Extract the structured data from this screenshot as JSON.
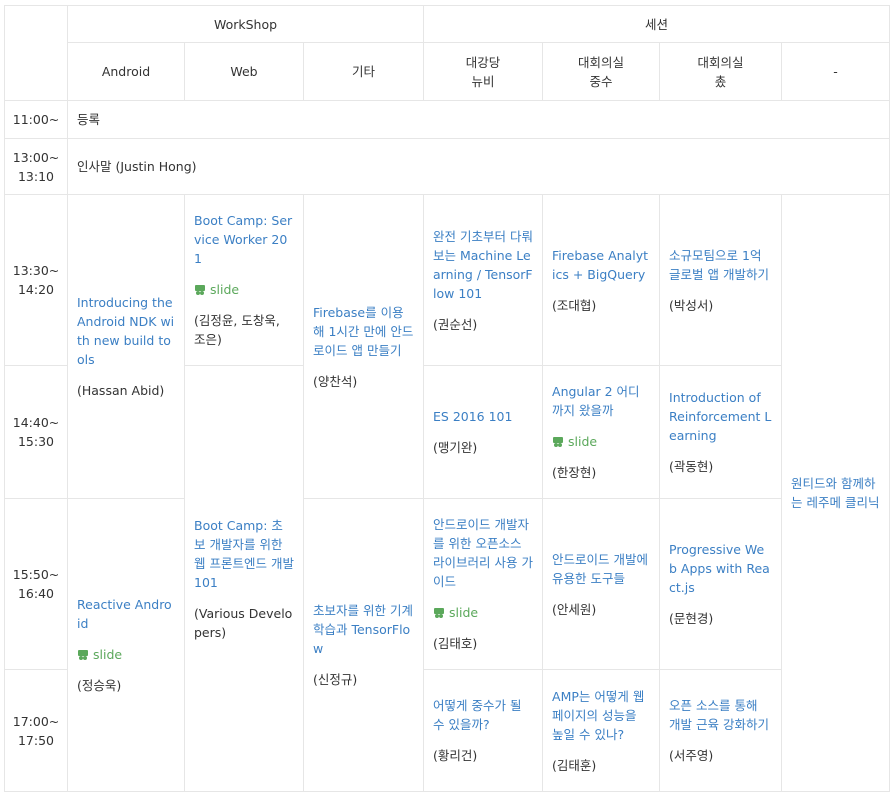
{
  "header": {
    "workshop": "WorkShop",
    "session": "세션",
    "cols": [
      "Android",
      "Web",
      "기타",
      "대강당\n뉴비",
      "대회의실\n중수",
      "대회의실\n촜",
      "-"
    ]
  },
  "times": {
    "t1100": "11:00~",
    "t1300": "13:00~\n13:10",
    "t1330": "13:30~\n14:20",
    "t1440": "14:40~\n15:30",
    "t1550": "15:50~\n16:40",
    "t1700": "17:00~\n17:50"
  },
  "events": {
    "register": "등록",
    "greeting": "인사말 (Justin Hong)"
  },
  "slide_label": "slide",
  "cells": {
    "android1": {
      "title": "Introducing the Android NDK with new build tools",
      "speaker": "(Hassan Abid)"
    },
    "web1": {
      "title": "Boot Camp: Service Worker 201",
      "speaker": "(김정윤, 도창욱, 조은)"
    },
    "etc1": {
      "title": "Firebase를 이용해 1시간 만에 안드로이드 앱 만들기",
      "speaker": "(양찬석)"
    },
    "newbie1": {
      "title": "완전 기초부터 다뤄보는 Machine Learning / TensorFlow 101",
      "speaker": "(권순선)"
    },
    "mid1": {
      "title": "Firebase Analytics + BigQuery",
      "speaker": "(조대협)"
    },
    "chong1": {
      "title": "소규모팀으로 1억 글로벌 앱 개발하기",
      "speaker": "(박성서)"
    },
    "newbie2": {
      "title": "ES 2016 101",
      "speaker": "(맹기완)"
    },
    "mid2": {
      "title": "Angular 2 어디까지 왔을까",
      "speaker": "(한장현)"
    },
    "chong2": {
      "title": "Introduction of Reinforcement Learning",
      "speaker": "(곽동현)"
    },
    "dash": {
      "title": "원티드와 함께하는 레주메 클리닉"
    },
    "android2": {
      "title": "Reactive Android",
      "speaker": "(정승욱)"
    },
    "web2": {
      "title": "Boot Camp: 초보 개발자를 위한 웹 프론트엔드 개발 101",
      "speaker": "(Various Developers)"
    },
    "etc2": {
      "title": "초보자를 위한 기계 학습과 TensorFlow",
      "speaker": "(신정규)"
    },
    "newbie3": {
      "title": "안드로이드 개발자를 위한 오픈소스 라이브러리 사용 가이드",
      "speaker": "(김태호)"
    },
    "mid3": {
      "title": "안드로이드 개발에 유용한 도구들",
      "speaker": "(안세원)"
    },
    "chong3": {
      "title": "Progressive Web Apps with React.js",
      "speaker": "(문현경)"
    },
    "newbie4": {
      "title": "어떻게 중수가 될 수 있을까?",
      "speaker": "(황리건)"
    },
    "mid4": {
      "title": "AMP는 어떻게 웹 페이지의 성능을 높일 수 있나?",
      "speaker": "(김태훈)"
    },
    "chong4": {
      "title": "오픈 소스를 통해 개발 근육 강화하기",
      "speaker": "(서주영)"
    }
  },
  "colors": {
    "link": "#3b7fc4",
    "slide": "#5ba85b",
    "border": "#e6e6e6",
    "text": "#333333"
  },
  "icons": {
    "slide": "slideshare-icon"
  }
}
